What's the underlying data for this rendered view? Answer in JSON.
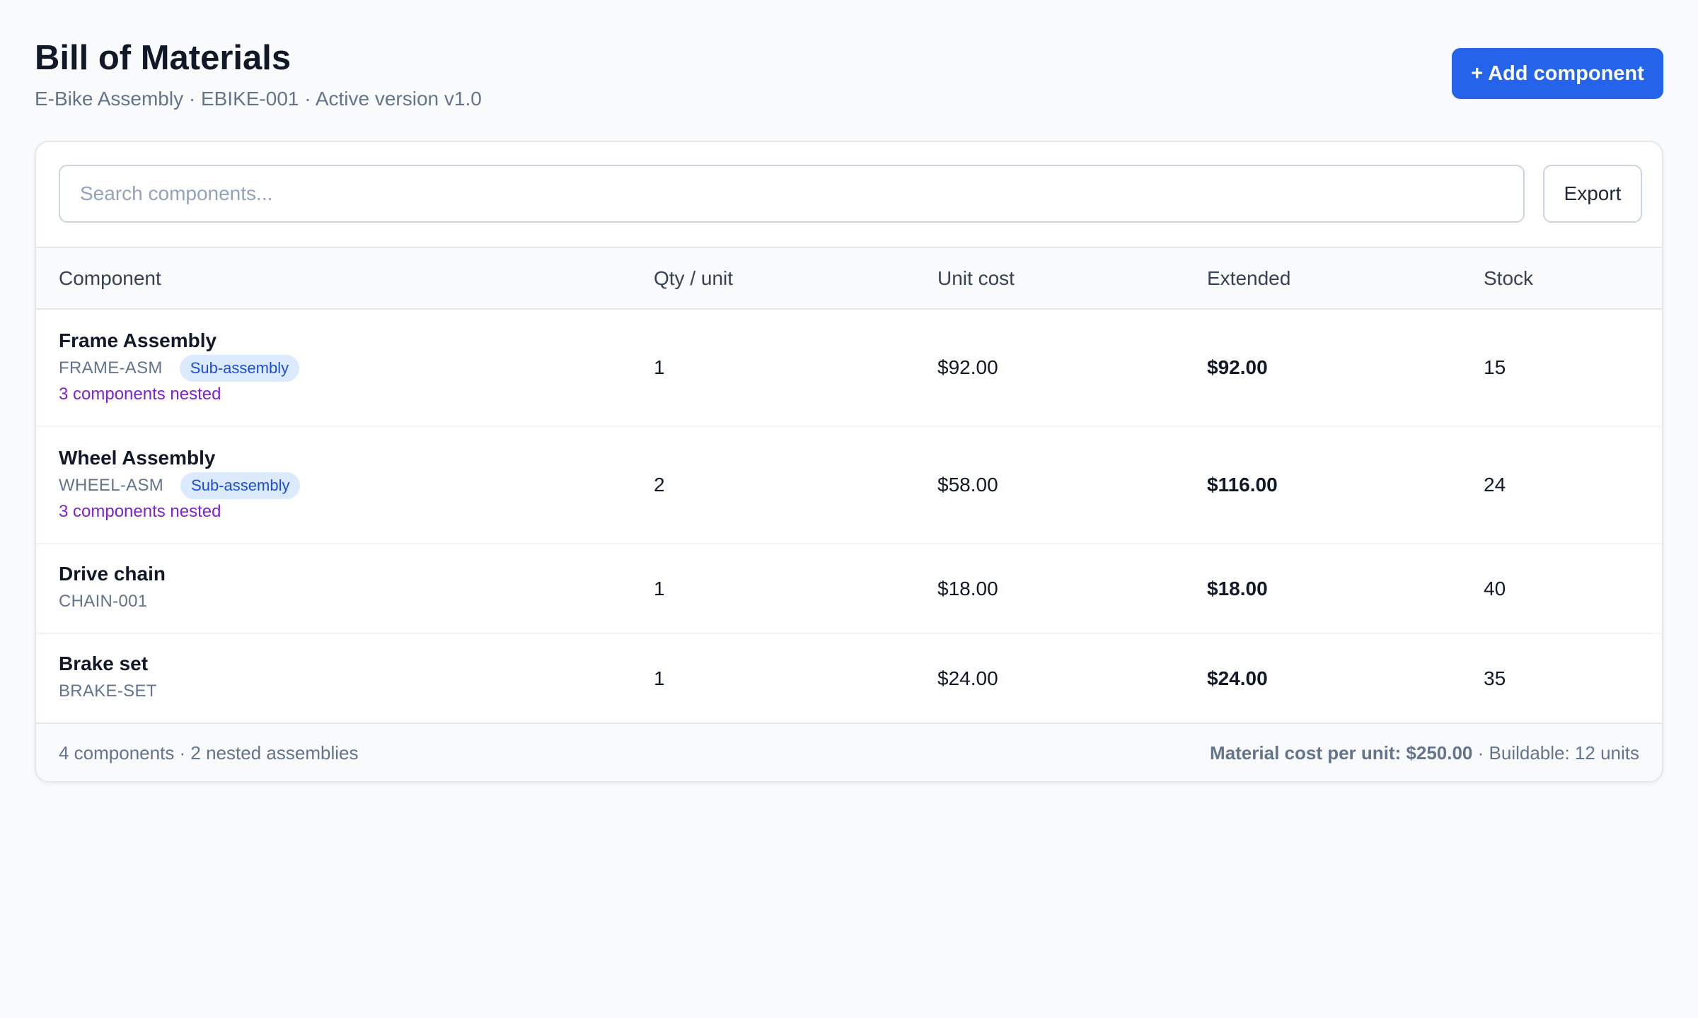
{
  "header": {
    "title": "Bill of Materials",
    "subtitle": "E-Bike Assembly · EBIKE-001 · Active version v1.0",
    "add_button_label": "+ Add component"
  },
  "toolbar": {
    "search_placeholder": "Search components...",
    "search_value": "",
    "export_label": "Export"
  },
  "table": {
    "columns": [
      "Component",
      "Qty / unit",
      "Unit cost",
      "Extended",
      "Stock"
    ],
    "rows": [
      {
        "name": "Frame Assembly",
        "sku": "FRAME-ASM",
        "badge": "Sub-assembly",
        "nested": "3 components nested",
        "qty": "1",
        "unit_cost": "$92.00",
        "extended": "$92.00",
        "stock": "15"
      },
      {
        "name": "Wheel Assembly",
        "sku": "WHEEL-ASM",
        "badge": "Sub-assembly",
        "nested": "3 components nested",
        "qty": "2",
        "unit_cost": "$58.00",
        "extended": "$116.00",
        "stock": "24"
      },
      {
        "name": "Drive chain",
        "sku": "CHAIN-001",
        "qty": "1",
        "unit_cost": "$18.00",
        "extended": "$18.00",
        "stock": "40"
      },
      {
        "name": "Brake set",
        "sku": "BRAKE-SET",
        "qty": "1",
        "unit_cost": "$24.00",
        "extended": "$24.00",
        "stock": "35"
      }
    ]
  },
  "footer": {
    "summary": "4 components · 2 nested assemblies",
    "cost_label": "Material cost per unit: $250.00",
    "buildable": " · Buildable: 12 units"
  },
  "colors": {
    "accent": "#2563eb",
    "badge_bg": "#dbeafe",
    "badge_text": "#1d4ed8",
    "nested_link": "#7e22ce",
    "page_bg": "#f8fafc"
  }
}
